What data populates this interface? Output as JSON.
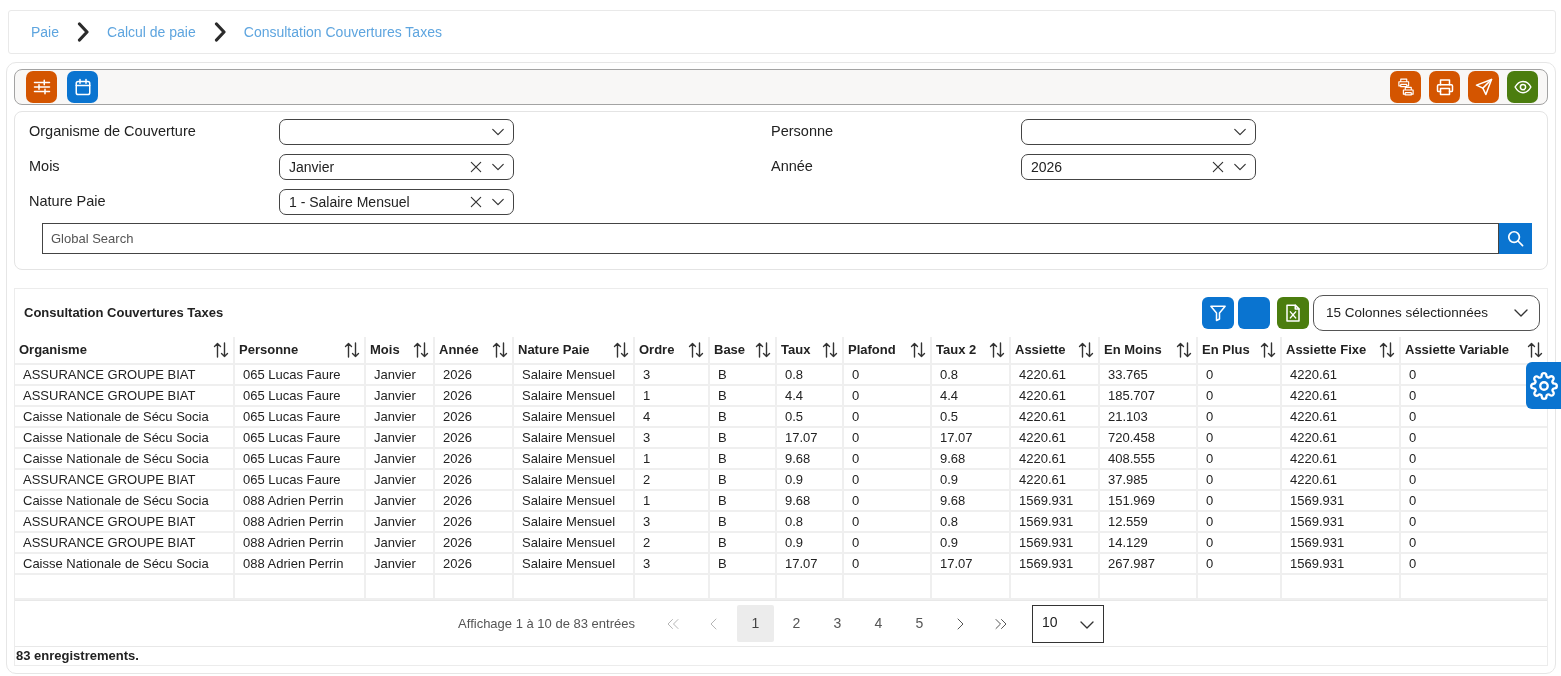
{
  "breadcrumb": [
    {
      "label": "Paie"
    },
    {
      "label": "Calcul de paie"
    },
    {
      "label": "Consultation Couvertures Taxes"
    }
  ],
  "toolbar": {
    "left": [
      {
        "kind": "sliders",
        "color": "#d45500"
      },
      {
        "kind": "calendar",
        "color": "#0a74d0"
      }
    ],
    "right": [
      {
        "kind": "printers",
        "color": "#d45500"
      },
      {
        "kind": "printer",
        "color": "#d45500"
      },
      {
        "kind": "send",
        "color": "#d45500"
      },
      {
        "kind": "eye",
        "color": "#4b7d0e"
      }
    ]
  },
  "filters": [
    {
      "label": "Organisme de Couverture"
    },
    {
      "label": "Personne"
    },
    {
      "label": "Mois",
      "value": "Janvier"
    },
    {
      "label": "Année",
      "value": "2026"
    },
    {
      "label": "Nature Paie",
      "value": "1 - Salaire Mensuel"
    }
  ],
  "search": {
    "placeholder": "Global Search"
  },
  "table": {
    "title": "Consultation Couvertures Taxes",
    "actions": [
      {
        "kind": "filter",
        "color": "#0a74d0"
      },
      {
        "kind": "blank",
        "color": "#0a74d0"
      },
      {
        "kind": "excel",
        "color": "#4b7d0e"
      }
    ],
    "columns_selector": "15 Colonnes sélectionnées",
    "columns": [
      "Organisme",
      "Personne",
      "Mois",
      "Année",
      "Nature Paie",
      "Ordre",
      "Base",
      "Taux",
      "Plafond",
      "Taux 2",
      "Assiette",
      "En Moins",
      "En Plus",
      "Assiette Fixe",
      "Assiette Variable"
    ],
    "rows": [
      [
        "ASSURANCE GROUPE BIAT",
        "065 Lucas Faure",
        "Janvier",
        "2026",
        "Salaire Mensuel",
        "3",
        "B",
        "0.8",
        "0",
        "0.8",
        "4220.61",
        "33.765",
        "0",
        "4220.61",
        "0"
      ],
      [
        "ASSURANCE GROUPE BIAT",
        "065 Lucas Faure",
        "Janvier",
        "2026",
        "Salaire Mensuel",
        "1",
        "B",
        "4.4",
        "0",
        "4.4",
        "4220.61",
        "185.707",
        "0",
        "4220.61",
        "0"
      ],
      [
        "Caisse Nationale de Sécu Socia",
        "065 Lucas Faure",
        "Janvier",
        "2026",
        "Salaire Mensuel",
        "4",
        "B",
        "0.5",
        "0",
        "0.5",
        "4220.61",
        "21.103",
        "0",
        "4220.61",
        "0"
      ],
      [
        "Caisse Nationale de Sécu Socia",
        "065 Lucas Faure",
        "Janvier",
        "2026",
        "Salaire Mensuel",
        "3",
        "B",
        "17.07",
        "0",
        "17.07",
        "4220.61",
        "720.458",
        "0",
        "4220.61",
        "0"
      ],
      [
        "Caisse Nationale de Sécu Socia",
        "065 Lucas Faure",
        "Janvier",
        "2026",
        "Salaire Mensuel",
        "1",
        "B",
        "9.68",
        "0",
        "9.68",
        "4220.61",
        "408.555",
        "0",
        "4220.61",
        "0"
      ],
      [
        "ASSURANCE GROUPE BIAT",
        "065 Lucas Faure",
        "Janvier",
        "2026",
        "Salaire Mensuel",
        "2",
        "B",
        "0.9",
        "0",
        "0.9",
        "4220.61",
        "37.985",
        "0",
        "4220.61",
        "0"
      ],
      [
        "Caisse Nationale de Sécu Socia",
        "088 Adrien Perrin",
        "Janvier",
        "2026",
        "Salaire Mensuel",
        "1",
        "B",
        "9.68",
        "0",
        "9.68",
        "1569.931",
        "151.969",
        "0",
        "1569.931",
        "0"
      ],
      [
        "ASSURANCE GROUPE BIAT",
        "088 Adrien Perrin",
        "Janvier",
        "2026",
        "Salaire Mensuel",
        "3",
        "B",
        "0.8",
        "0",
        "0.8",
        "1569.931",
        "12.559",
        "0",
        "1569.931",
        "0"
      ],
      [
        "ASSURANCE GROUPE BIAT",
        "088 Adrien Perrin",
        "Janvier",
        "2026",
        "Salaire Mensuel",
        "2",
        "B",
        "0.9",
        "0",
        "0.9",
        "1569.931",
        "14.129",
        "0",
        "1569.931",
        "0"
      ],
      [
        "Caisse Nationale de Sécu Socia",
        "088 Adrien Perrin",
        "Janvier",
        "2026",
        "Salaire Mensuel",
        "3",
        "B",
        "17.07",
        "0",
        "17.07",
        "1569.931",
        "267.987",
        "0",
        "1569.931",
        "0"
      ]
    ]
  },
  "pagination": {
    "summary": "Affichage 1 à 10 de 83 entrées",
    "first": {
      "disabled": true
    },
    "previous": {
      "disabled": true
    },
    "pages": [
      {
        "label": "1",
        "selected": true
      },
      {
        "label": "2",
        "selected": false
      },
      {
        "label": "3",
        "selected": false
      },
      {
        "label": "4",
        "selected": false
      },
      {
        "label": "5",
        "selected": false
      }
    ],
    "next": {
      "disabled": false
    },
    "last": {
      "disabled": false
    },
    "page_size": "10"
  },
  "record_count": "83 enregistrements."
}
